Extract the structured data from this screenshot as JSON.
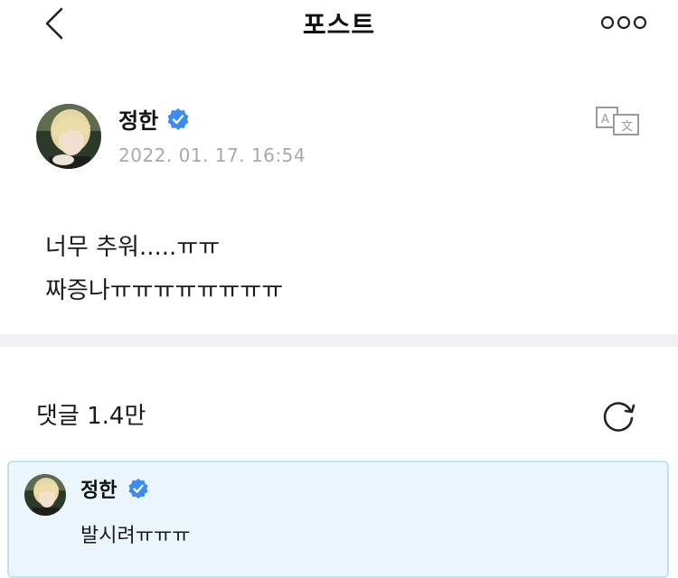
{
  "header": {
    "title": "포스트",
    "back_icon": "chevron-left-icon",
    "more_icon": "more-dots-icon"
  },
  "post": {
    "author": "정한",
    "verified": true,
    "timestamp": "2022. 01. 17. 16:54",
    "translate_icon": "translate-icon",
    "lines": [
      "너무 추워.....ㅠㅠ",
      "짜증나ㅠㅠㅠㅠㅠㅠㅠㅠ"
    ]
  },
  "comments": {
    "label": "댓글 1.4만",
    "refresh_icon": "refresh-icon",
    "items": [
      {
        "author": "정한",
        "verified": true,
        "text": "발시려ㅠㅠㅠ",
        "highlighted": true
      }
    ]
  },
  "colors": {
    "verified": "#3b8cf0",
    "timestamp": "#a8a8a8",
    "highlight_bg": "#eaf6fb",
    "highlight_border": "#bde2f2",
    "divider": "#f1f1f3"
  }
}
